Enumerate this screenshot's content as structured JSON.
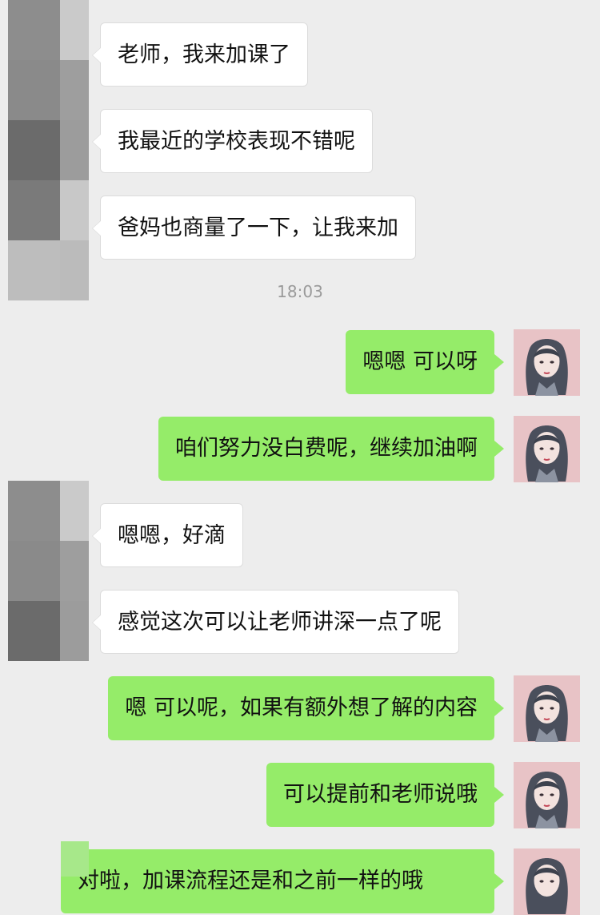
{
  "chat": {
    "timestamp": "18:03",
    "messages": [
      {
        "side": "left",
        "text": "老师，我来加课了"
      },
      {
        "side": "left",
        "text": "我最近的学校表现不错呢"
      },
      {
        "side": "left",
        "text": "爸妈也商量了一下，让我来加"
      },
      {
        "side": "right",
        "text": "嗯嗯 可以呀"
      },
      {
        "side": "right",
        "text": "咱们努力没白费呢，继续加油啊"
      },
      {
        "side": "left",
        "text": "嗯嗯，好滴"
      },
      {
        "side": "left",
        "text": "感觉这次可以让老师讲深一点了呢"
      },
      {
        "side": "right",
        "text": "嗯 可以呢，如果有额外想了解的内容"
      },
      {
        "side": "right",
        "text": "可以提前和老师说哦"
      },
      {
        "side": "right",
        "text": "对啦，加课流程还是和之前一样的哦"
      }
    ]
  },
  "colors": {
    "background": "#ededed",
    "incoming_bubble": "#ffffff",
    "outgoing_bubble": "#95ec69",
    "timestamp": "#9a9a9a"
  },
  "icons": {
    "contact_avatar": "pixelated-avatar-icon",
    "self_avatar": "girl-avatar-icon"
  }
}
